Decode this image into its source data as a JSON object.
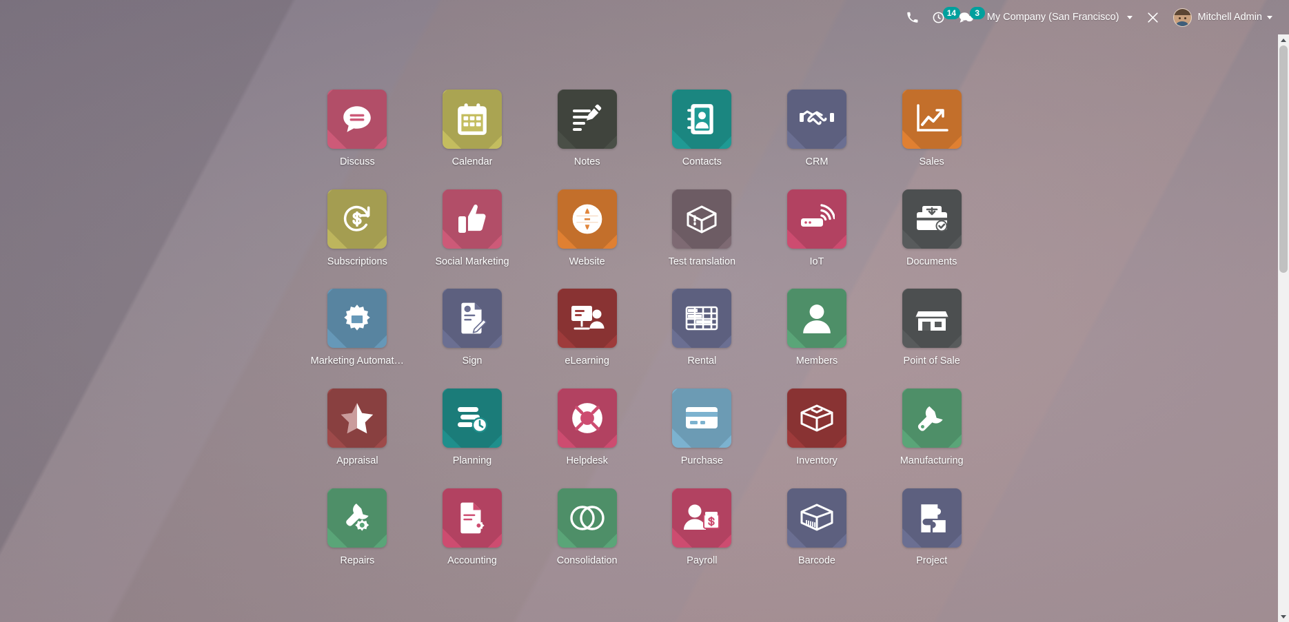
{
  "navbar": {
    "phone_icon": "phone-icon",
    "activities": {
      "icon": "clock-activity-icon",
      "count": "14"
    },
    "messages": {
      "icon": "messages-chat-icon",
      "count": "3"
    },
    "company": "My Company (San Francisco)",
    "debug_icon": "debug-wrench-icon",
    "user_name": "Mitchell Admin",
    "avatar": "user-avatar"
  },
  "colors": {
    "accent_teal": "#00a09d",
    "navbar_text": "#ffffff",
    "wallpaper_base": "#9e8f95"
  },
  "apps": [
    {
      "name": "Discuss",
      "icon": "discuss-chat-bubble-icon",
      "bg": "#cd5a78"
    },
    {
      "name": "Calendar",
      "icon": "calendar-icon",
      "bg": "#c4bd5f"
    },
    {
      "name": "Notes",
      "icon": "notes-pencil-icon",
      "bg": "#4a4f47"
    },
    {
      "name": "Contacts",
      "icon": "contacts-addressbook-icon",
      "bg": "#1f9a94"
    },
    {
      "name": "CRM",
      "icon": "crm-handshake-icon",
      "bg": "#6b6f92"
    },
    {
      "name": "Sales",
      "icon": "sales-growth-chart-icon",
      "bg": "#e08032"
    },
    {
      "name": "Subscriptions",
      "icon": "subscriptions-recurring-icon",
      "bg": "#bdb55d"
    },
    {
      "name": "Social Marketing",
      "icon": "social-thumbs-up-icon",
      "bg": "#cd5a78"
    },
    {
      "name": "Website",
      "icon": "website-globe-icon",
      "bg": "#e08032"
    },
    {
      "name": "Test translation",
      "icon": "test-translation-box-icon",
      "bg": "#7e6a73"
    },
    {
      "name": "IoT",
      "icon": "iot-router-signal-icon",
      "bg": "#cd4c70"
    },
    {
      "name": "Documents",
      "icon": "documents-folder-check-icon",
      "bg": "#585b5c"
    },
    {
      "name": "Marketing Automat…",
      "icon": "marketing-automation-gear-mail-icon",
      "bg": "#6698b8"
    },
    {
      "name": "Sign",
      "icon": "sign-document-pen-icon",
      "bg": "#6b6f92"
    },
    {
      "name": "eLearning",
      "icon": "elearning-presentation-icon",
      "bg": "#9e3b3b"
    },
    {
      "name": "Rental",
      "icon": "rental-calendar-grid-icon",
      "bg": "#6b6f92"
    },
    {
      "name": "Members",
      "icon": "members-person-icon",
      "bg": "#5aa578"
    },
    {
      "name": "Point of Sale",
      "icon": "point-of-sale-shop-icon",
      "bg": "#585b5c"
    },
    {
      "name": "Appraisal",
      "icon": "appraisal-half-star-icon",
      "bg": "#9e4a4a"
    },
    {
      "name": "Planning",
      "icon": "planning-bars-clock-icon",
      "bg": "#1f8f8c"
    },
    {
      "name": "Helpdesk",
      "icon": "helpdesk-life-ring-icon",
      "bg": "#cd4c70"
    },
    {
      "name": "Purchase",
      "icon": "purchase-credit-card-icon",
      "bg": "#7cb2cf"
    },
    {
      "name": "Inventory",
      "icon": "inventory-open-box-icon",
      "bg": "#9e3b3b"
    },
    {
      "name": "Manufacturing",
      "icon": "manufacturing-wrench-icon",
      "bg": "#5aa578"
    },
    {
      "name": "Repairs",
      "icon": "repairs-wrench-gear-icon",
      "bg": "#5aa578"
    },
    {
      "name": "Accounting",
      "icon": "accounting-document-gear-icon",
      "bg": "#cd4c70"
    },
    {
      "name": "Consolidation",
      "icon": "consolidation-circles-icon",
      "bg": "#5aa578"
    },
    {
      "name": "Payroll",
      "icon": "payroll-person-money-icon",
      "bg": "#cd4c70"
    },
    {
      "name": "Barcode",
      "icon": "barcode-box-icon",
      "bg": "#6b6f92"
    },
    {
      "name": "Project",
      "icon": "project-puzzle-icon",
      "bg": "#6b6f92"
    }
  ],
  "scrollbar": {
    "up_arrow": "scroll-up-arrow-icon",
    "down_arrow": "scroll-down-arrow-icon"
  }
}
